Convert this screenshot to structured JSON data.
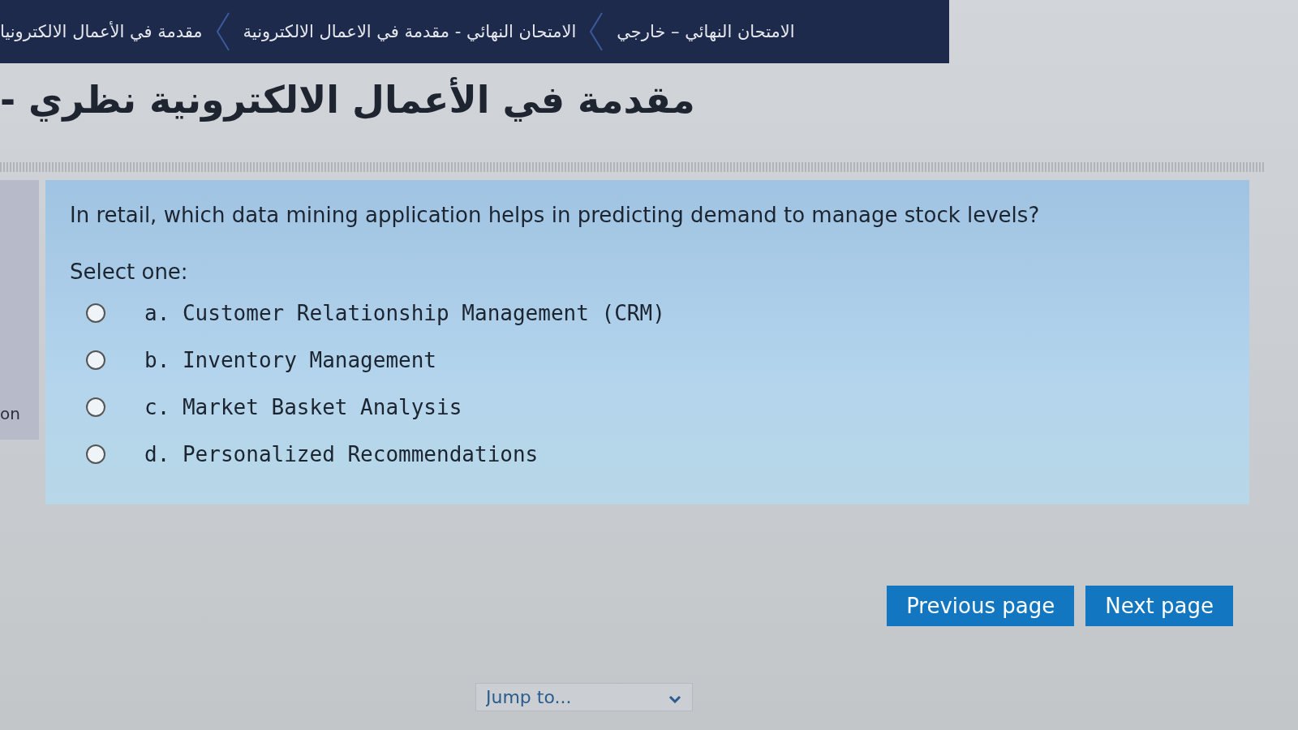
{
  "breadcrumb": [
    {
      "label": "الامتحان النهائي – خارجي"
    },
    {
      "label": "الامتحان النهائي - مقدمة في الاعمال الالكترونية"
    },
    {
      "label": "مقدمة في الأعمال الالكترونيا"
    }
  ],
  "title": "مقدمة في الأعمال الالكترونية نظري -",
  "side_text": "on",
  "question": {
    "text": "In retail, which data mining application helps in predicting demand to manage stock levels?",
    "prompt": "Select one:",
    "options": [
      {
        "label": "a. Customer Relationship Management (CRM)",
        "selected": false
      },
      {
        "label": "b. Inventory Management",
        "selected": false
      },
      {
        "label": "c. Market Basket Analysis",
        "selected": false
      },
      {
        "label": "d. Personalized Recommendations",
        "selected": false
      }
    ]
  },
  "navigation": {
    "previous_button": "Previous page",
    "next_button": "Next page"
  },
  "jump": {
    "placeholder": "Jump to..."
  }
}
